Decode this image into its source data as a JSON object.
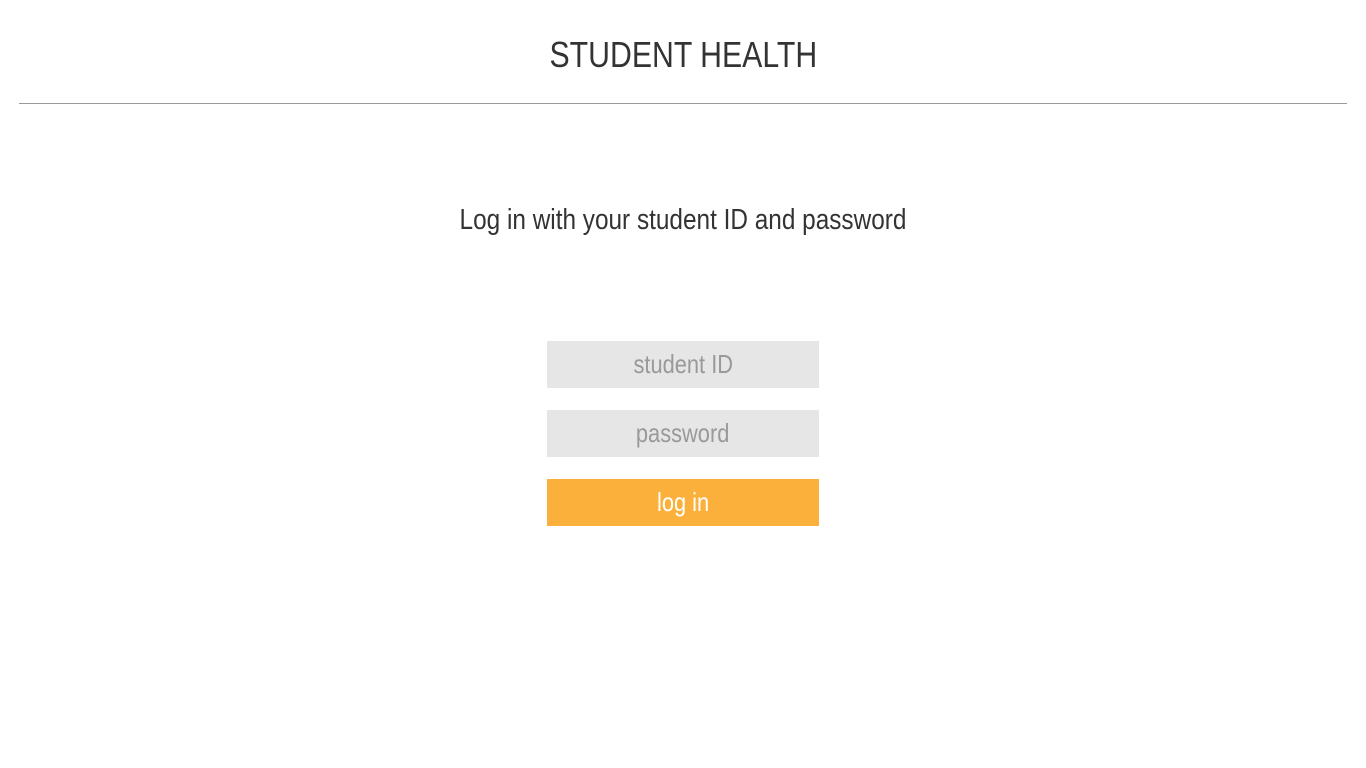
{
  "header": {
    "title": "STUDENT HEALTH"
  },
  "login": {
    "instruction": "Log in with your student ID and password",
    "student_id_placeholder": "student ID",
    "password_placeholder": "password",
    "submit_label": "log in"
  },
  "colors": {
    "accent": "#fbb03b",
    "field_bg": "#e6e6e6",
    "text": "#333333"
  }
}
